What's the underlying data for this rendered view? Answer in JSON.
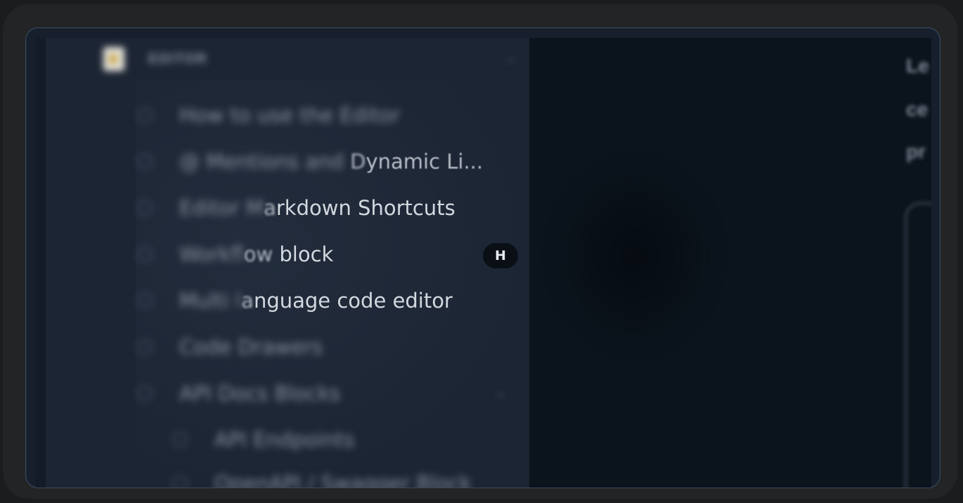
{
  "sidebar": {
    "section": {
      "title": "EDITOR",
      "icon": "notepad-icon"
    },
    "items": [
      {
        "label_fade": "How to use the Editor",
        "label_mid": "",
        "label_clear": ""
      },
      {
        "label_fade": "@ Mentions and ",
        "label_mid": "D",
        "label_clear": "ynamic Li..."
      },
      {
        "label_fade": "Editor M",
        "label_mid": "a",
        "label_clear": "rkdown Shortcuts"
      },
      {
        "label_fade": "Workf",
        "label_mid": "low",
        "label_clear": " block",
        "shortcut": "H"
      },
      {
        "label_fade": "Multi l",
        "label_mid": "a",
        "label_clear": "nguage code editor"
      },
      {
        "label_fade": "Code Drawers",
        "label_mid": "",
        "label_clear": ""
      },
      {
        "label_fade": "API Docs Blocks",
        "label_mid": "",
        "label_clear": ""
      },
      {
        "label_fade": "API Endpoints",
        "label_mid": "",
        "label_clear": ""
      },
      {
        "label_fade": "OpenAPI / Swagger Block",
        "label_mid": "",
        "label_clear": ""
      }
    ]
  },
  "content": {
    "lines": [
      "Le",
      "ce",
      "pr"
    ]
  }
}
